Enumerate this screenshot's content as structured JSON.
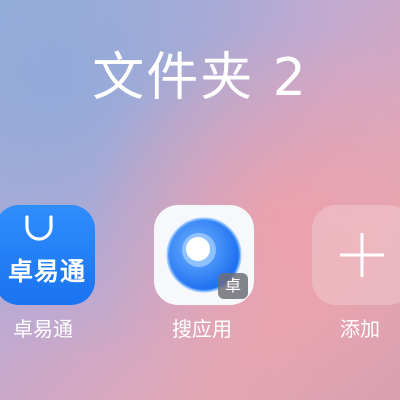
{
  "folder": {
    "title": "文件夹 2"
  },
  "apps": [
    {
      "label": "卓易通",
      "icon_text": "卓易通",
      "icon": "shopping-bag-icon",
      "color": "#1f7cf4"
    },
    {
      "label": "搜应用",
      "badge": "卓",
      "icon": "ring-search-icon",
      "color": "#2a7cf0"
    },
    {
      "label": "添加",
      "icon": "plus-icon"
    }
  ]
}
